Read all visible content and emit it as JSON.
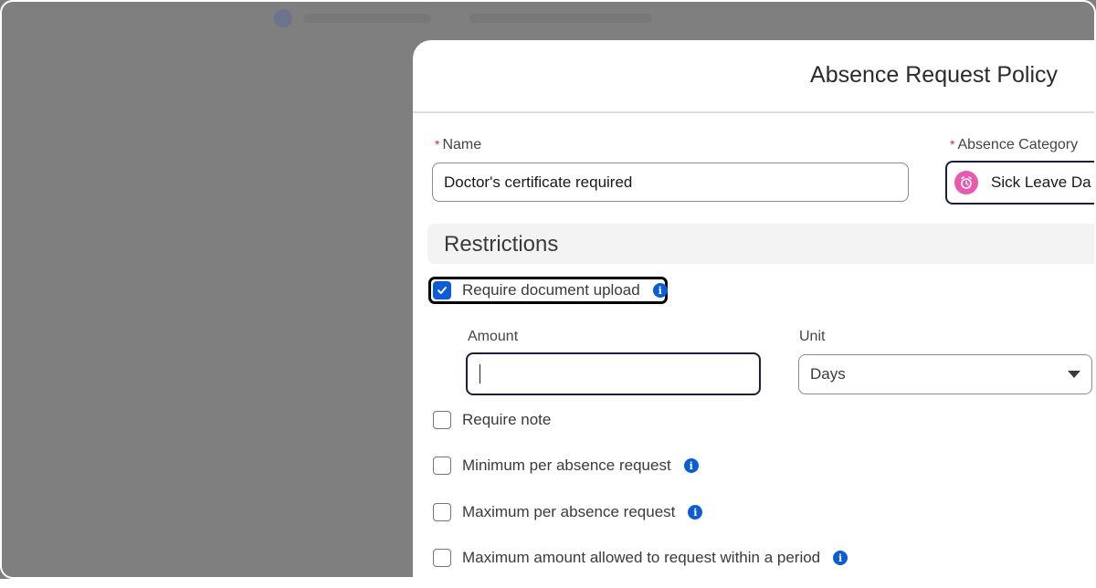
{
  "modal": {
    "title": "Absence Request Policy"
  },
  "name_field": {
    "label": "Name",
    "value": "Doctor's certificate required"
  },
  "category_field": {
    "label": "Absence Category",
    "value": "Sick Leave Da"
  },
  "restrictions": {
    "title": "Restrictions",
    "require_document": {
      "label": "Require document upload",
      "checked": true
    },
    "amount": {
      "label": "Amount",
      "value": ""
    },
    "unit": {
      "label": "Unit",
      "value": "Days"
    },
    "options": [
      {
        "label": "Require note",
        "checked": false
      },
      {
        "label": "Minimum per absence request",
        "checked": false
      },
      {
        "label": "Maximum per absence request",
        "checked": false
      },
      {
        "label": "Maximum amount allowed to request within a period",
        "checked": false
      }
    ]
  },
  "colors": {
    "accent": "#0b5cd5",
    "required": "#c23934",
    "category_icon": "#e85aad"
  },
  "icons": {
    "category": "alarm-clock-icon",
    "info": "info-icon",
    "check": "checkmark-icon",
    "dropdown": "caret-down-icon"
  }
}
